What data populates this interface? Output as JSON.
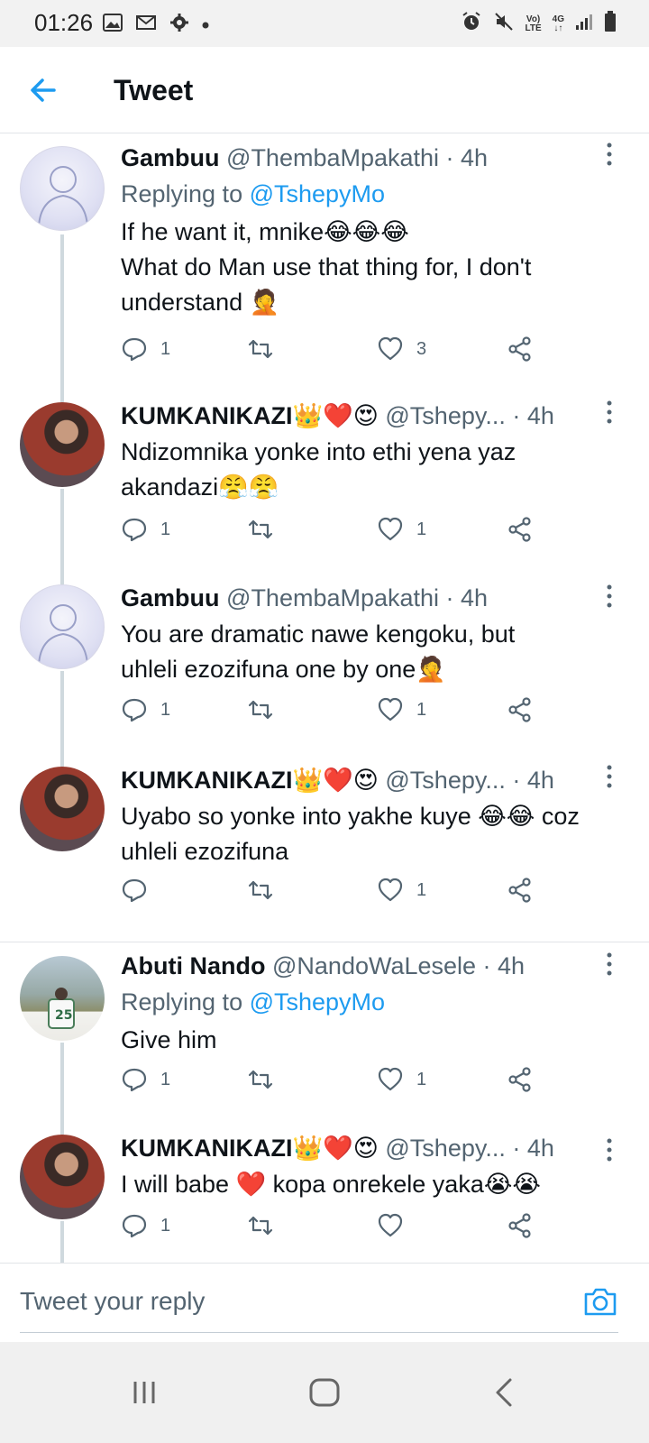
{
  "status_bar": {
    "time": "01:26",
    "network_label_top": "Vo)",
    "network_label_bottom": "LTE",
    "network_type": "4G"
  },
  "header": {
    "title": "Tweet"
  },
  "tweets": [
    {
      "name": "Gambuu",
      "handle": "@ThembaMpakathi · 4h",
      "replying_prefix": "Replying to ",
      "replying_to": "@TshepyMo",
      "text_lines": [
        "If he want it, mnike😂😂😂",
        "What do Man use that thing for, I don't",
        "understand 🤦"
      ],
      "replies": "1",
      "retweets": "",
      "likes": "3"
    },
    {
      "name": "KUMKANIKAZI👑❤️😍",
      "handle": " @Tshepy... · 4h",
      "text_lines": [
        "Ndizomnika yonke into ethi yena yaz",
        "akandazi😤😤"
      ],
      "replies": "1",
      "retweets": "",
      "likes": "1"
    },
    {
      "name": "Gambuu",
      "handle": "@ThembaMpakathi · 4h",
      "text_lines": [
        "You are dramatic nawe kengoku, but",
        "uhleli ezozifuna one by one🤦"
      ],
      "replies": "1",
      "retweets": "",
      "likes": "1"
    },
    {
      "name": "KUMKANIKAZI👑❤️😍",
      "handle": " @Tshepy... · 4h",
      "text_lines": [
        "Uyabo so yonke into yakhe kuye 😂😂 coz",
        "uhleli ezozifuna"
      ],
      "replies": "",
      "retweets": "",
      "likes": "1"
    },
    {
      "name": "Abuti Nando",
      "handle": "@NandoWaLesele · 4h",
      "replying_prefix": "Replying to ",
      "replying_to": "@TshepyMo",
      "text_lines": [
        "Give him"
      ],
      "replies": "1",
      "retweets": "",
      "likes": "1"
    },
    {
      "name": "KUMKANIKAZI👑❤️😍",
      "handle": " @Tshepy... · 4h",
      "text_lines": [
        "I will babe ❤️ kopa onrekele yaka😭😭"
      ],
      "replies": "1",
      "retweets": "",
      "likes": ""
    }
  ],
  "reply_bar": {
    "placeholder": "Tweet your reply"
  },
  "colors": {
    "accent": "#1d9bf0",
    "secondary_text": "#536471",
    "thread_line": "#cfd9de"
  }
}
